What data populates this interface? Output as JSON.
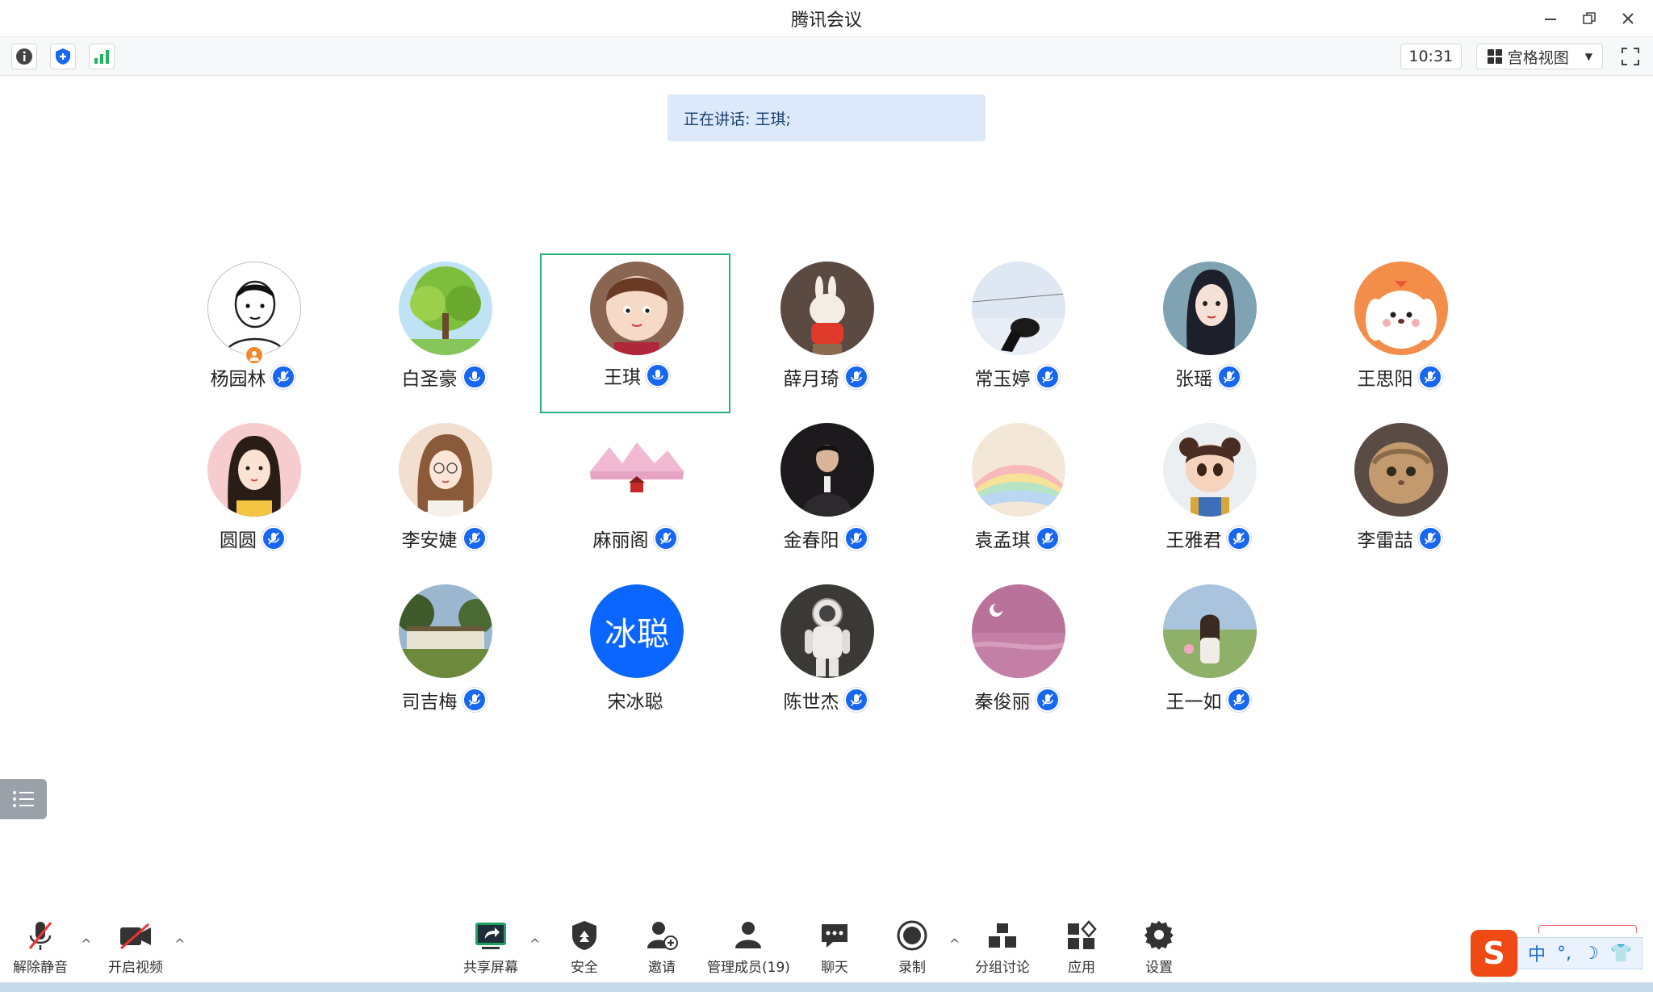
{
  "window": {
    "title": "腾讯会议",
    "controls": [
      "minimize-icon",
      "restore-icon",
      "close-icon"
    ]
  },
  "toolbar": {
    "left_icons": [
      "info-icon",
      "shield-icon",
      "signal-icon"
    ],
    "clock": "10:31",
    "view_label": "宫格视图",
    "fullscreen_icon": "fullscreen-icon"
  },
  "speaking": {
    "text": "正在讲话: 王琪;"
  },
  "participants": [
    {
      "name": "杨园林",
      "avatar": "cartoon-boy",
      "mic": "muted",
      "host": true
    },
    {
      "name": "白圣豪",
      "avatar": "tree",
      "mic": "on"
    },
    {
      "name": "王琪",
      "avatar": "cartoon-girl",
      "mic": "on",
      "active": true
    },
    {
      "name": "薛月琦",
      "avatar": "rabbit",
      "mic": "muted"
    },
    {
      "name": "常玉婷",
      "avatar": "sky-girl",
      "mic": "muted"
    },
    {
      "name": "张瑶",
      "avatar": "anime-girl",
      "mic": "muted"
    },
    {
      "name": "王思阳",
      "avatar": "cartoon-dog",
      "mic": "muted"
    },
    {
      "name": "圆圆",
      "avatar": "cartoon-girl-2",
      "mic": "muted"
    },
    {
      "name": "李安婕",
      "avatar": "glasses-girl",
      "mic": "muted"
    },
    {
      "name": "麻丽阁",
      "avatar": "snow-house",
      "mic": "muted"
    },
    {
      "name": "金春阳",
      "avatar": "man-suit",
      "mic": "muted"
    },
    {
      "name": "袁孟琪",
      "avatar": "rainbow",
      "mic": "muted"
    },
    {
      "name": "王雅君",
      "avatar": "cartoon-child",
      "mic": "muted"
    },
    {
      "name": "李雷喆",
      "avatar": "cat",
      "mic": "muted"
    },
    {
      "name": "司吉梅",
      "avatar": "building",
      "mic": "muted"
    },
    {
      "name": "宋冰聪",
      "avatar_text": "冰聪",
      "mic": "none"
    },
    {
      "name": "陈世杰",
      "avatar": "astronaut",
      "mic": "muted"
    },
    {
      "name": "秦俊丽",
      "avatar": "pink-sky",
      "mic": "muted"
    },
    {
      "name": "王一如",
      "avatar": "field-girl",
      "mic": "muted"
    }
  ],
  "bottombar": {
    "unmute": "解除静音",
    "video": "开启视频",
    "share": "共享屏幕",
    "security": "安全",
    "invite": "邀请",
    "members": "管理成员(19)",
    "chat": "聊天",
    "record": "录制",
    "breakout": "分组讨论",
    "apps": "应用",
    "settings": "设置"
  },
  "ime": {
    "logo": "S",
    "mode": "中",
    "punct": "°,"
  },
  "colors": {
    "accent_blue": "#1867f0",
    "active_border": "#27b37a",
    "banner_bg": "#dbe9fb",
    "host_badge": "#f08a2c"
  }
}
